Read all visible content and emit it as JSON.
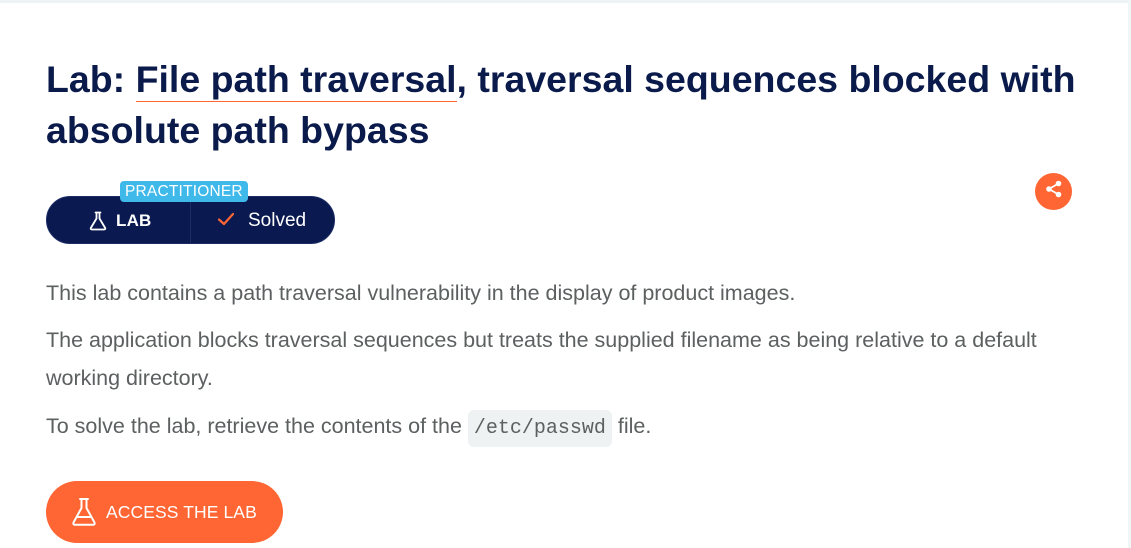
{
  "title": {
    "prefix": "Lab: ",
    "link_text": "File path traversal",
    "suffix": ", traversal sequences blocked with absolute path bypass"
  },
  "badge": {
    "level": "PRACTITIONER",
    "lab_label": "LAB",
    "status": "Solved",
    "lab_icon": "flask-icon",
    "status_icon": "checkmark-icon"
  },
  "share": {
    "icon": "share-icon"
  },
  "description": {
    "p1": "This lab contains a path traversal vulnerability in the display of product images.",
    "p2": "The application blocks traversal sequences but treats the supplied filename as being relative to a default working directory.",
    "p3_before": "To solve the lab, retrieve the contents of the ",
    "p3_code": "/etc/passwd",
    "p3_after": " file."
  },
  "access_button": {
    "label": "ACCESS THE LAB",
    "icon": "flask-icon"
  },
  "colors": {
    "navy": "#0a1a50",
    "accent_orange": "#ff6633",
    "level_blue": "#3fb9ea",
    "body_text": "#5c6060"
  }
}
